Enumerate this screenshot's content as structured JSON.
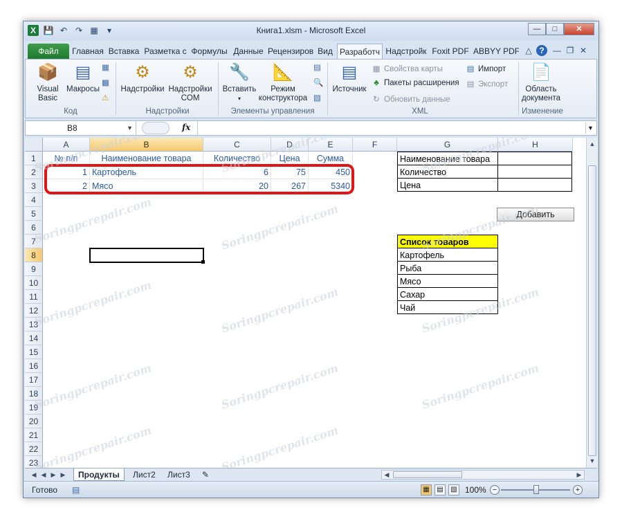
{
  "window": {
    "title": "Книга1.xlsm - Microsoft Excel"
  },
  "tabs": [
    "Файл",
    "Главная",
    "Вставка",
    "Разметка с",
    "Формулы",
    "Данные",
    "Рецензиров",
    "Вид",
    "Разработч",
    "Надстройк",
    "Foxit PDF",
    "ABBYY PDF"
  ],
  "ribbon": {
    "visual_basic": "Visual Basic",
    "macros": "Макросы",
    "addins": "Надстройки",
    "com_addins": "Надстройки COM",
    "insert": "Вставить",
    "design_mode": "Режим конструктора",
    "source": "Источник",
    "map_properties": "Свойства карты",
    "expansion_packs": "Пакеты расширения",
    "refresh_data": "Обновить данные",
    "import": "Импорт",
    "export": "Экспорт",
    "doc_panel": "Область документа",
    "groups": {
      "code": "Код",
      "addins": "Надстройки",
      "controls": "Элементы управления",
      "xml": "XML",
      "modify": "Изменение"
    }
  },
  "formula_bar": {
    "name_box": "B8",
    "fx": "fx",
    "formula": ""
  },
  "columns": [
    "A",
    "B",
    "C",
    "D",
    "E",
    "F",
    "G",
    "H"
  ],
  "rows": [
    "1",
    "2",
    "3",
    "4",
    "5",
    "6",
    "7",
    "8",
    "9",
    "10",
    "11",
    "12",
    "13",
    "14",
    "15",
    "16",
    "17",
    "18",
    "19",
    "20",
    "21",
    "22",
    "23"
  ],
  "sheet": {
    "headers": [
      "№ п/п",
      "Наименование товара",
      "Количество",
      "Цена",
      "Сумма"
    ],
    "rows": [
      {
        "n": "1",
        "name": "Картофель",
        "qty": "6",
        "price": "75",
        "sum": "450"
      },
      {
        "n": "2",
        "name": "Мясо",
        "qty": "20",
        "price": "267",
        "sum": "5340"
      }
    ],
    "form_labels": [
      "Наименование товара",
      "Количество",
      "Цена"
    ],
    "add_button": "Добавить",
    "list_title": "Список товаров",
    "list_items": [
      "Картофель",
      "Рыба",
      "Мясо",
      "Сахар",
      "Чай"
    ]
  },
  "sheet_tabs": [
    "Продукты",
    "Лист2",
    "Лист3"
  ],
  "status": {
    "text": "Готово",
    "zoom": "100%"
  },
  "watermark": "Soringpcrepair.com",
  "colors": {
    "file_tab": "#2a8a3a",
    "highlight_red": "#e01515",
    "list_header_bg": "#ffff00",
    "cell_text_blue": "#2b58a6"
  }
}
